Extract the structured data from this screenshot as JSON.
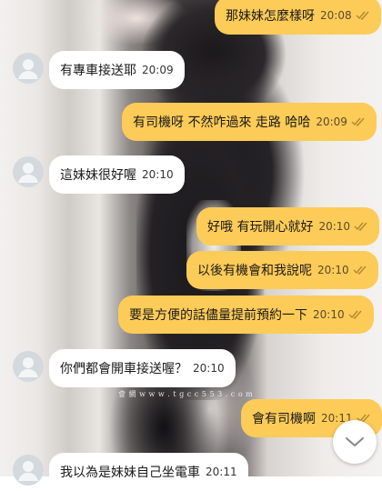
{
  "watermark": "會 網 w w w . t g c c 5 5 3 . c o m",
  "messages": [
    {
      "dir": "out",
      "text": "那妹妹怎麼樣呀",
      "time": "20:08"
    },
    {
      "dir": "in",
      "text": "有專車接送耶",
      "time": "20:09"
    },
    {
      "dir": "out",
      "text": "有司機呀 不然咋過來 走路 哈哈",
      "time": "20:09"
    },
    {
      "dir": "in",
      "text": "這妹妹很好喔",
      "time": "20:10"
    },
    {
      "dir": "out",
      "text": "好哦 有玩開心就好",
      "time": "20:10"
    },
    {
      "dir": "out",
      "text": "以後有機會和我說呢",
      "time": "20:10"
    },
    {
      "dir": "out",
      "text": "要是方便的話儘量提前預約一下",
      "time": "20:10"
    },
    {
      "dir": "in",
      "text": "你們都會開車接送喔？",
      "time": "20:10"
    },
    {
      "dir": "out",
      "text": "會有司機啊",
      "time": "20:11"
    },
    {
      "dir": "in",
      "text": "我以為是妹妹自己坐電車",
      "time": "20:11"
    }
  ],
  "colors": {
    "outgoing": "#fdcb57",
    "incoming": "#ffffff",
    "check": "#b08a2e"
  },
  "icons": {
    "avatar": "default-user-icon",
    "read": "double-check-icon",
    "scroll": "chevron-down-icon"
  }
}
